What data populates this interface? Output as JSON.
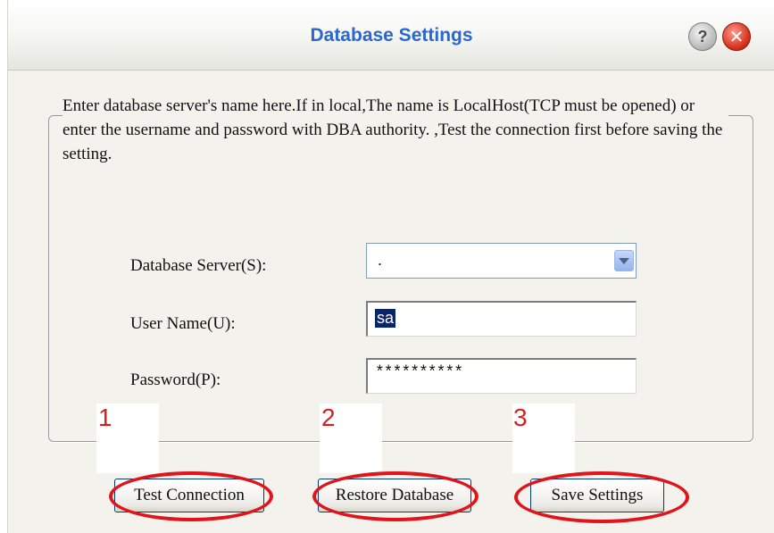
{
  "window": {
    "title": "Database Settings",
    "help_glyph": "?",
    "close_glyph": "✕"
  },
  "description": "Enter database server's name here.If in local,The name is LocalHost(TCP must be opened) or enter the username and password with DBA authority. ,Test the connection first before saving the setting.",
  "fields": {
    "server": {
      "label": "Database Server(S):",
      "value": "."
    },
    "user": {
      "label": "User Name(U):",
      "value": "sa"
    },
    "password": {
      "label": "Password(P):",
      "value": "**********"
    }
  },
  "annotations": {
    "one": "1",
    "two": "2",
    "three": "3",
    "color": "#d81f1f"
  },
  "buttons": {
    "test": "Test Connection",
    "restore": "Restore Database",
    "save": "Save Settings"
  },
  "icons": {
    "help": "help-icon",
    "close": "close-icon",
    "dropdown": "chevron-down-icon"
  },
  "colors": {
    "title": "#2a67d0",
    "ring": "#e0141a",
    "selection": "#0a246a"
  }
}
